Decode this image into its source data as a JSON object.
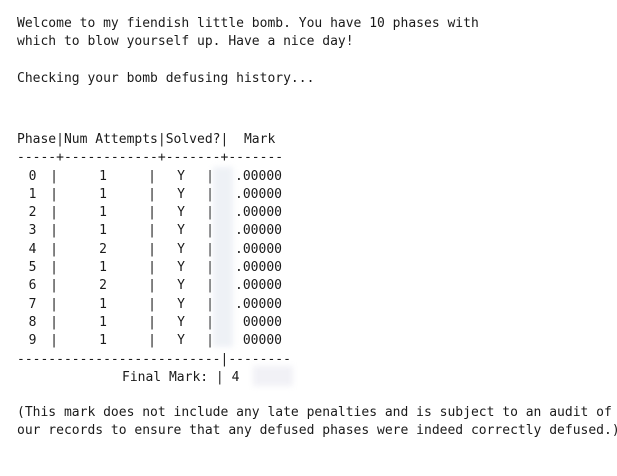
{
  "intro": {
    "line1": "Welcome to my fiendish little bomb. You have 10 phases with",
    "line2": "which to blow yourself up. Have a nice day!",
    "checking": "Checking your bomb defusing history..."
  },
  "table": {
    "header": "Phase|Num Attempts|Solved?|  Mark",
    "separator_top": "-----+------------+-------+-------",
    "rows": [
      {
        "phase": "0",
        "attempts": "1",
        "solved": "Y",
        "mark": ".00000"
      },
      {
        "phase": "1",
        "attempts": "1",
        "solved": "Y",
        "mark": ".00000"
      },
      {
        "phase": "2",
        "attempts": "1",
        "solved": "Y",
        "mark": ".00000"
      },
      {
        "phase": "3",
        "attempts": "1",
        "solved": "Y",
        "mark": ".00000"
      },
      {
        "phase": "4",
        "attempts": "2",
        "solved": "Y",
        "mark": ".00000"
      },
      {
        "phase": "5",
        "attempts": "1",
        "solved": "Y",
        "mark": ".00000"
      },
      {
        "phase": "6",
        "attempts": "2",
        "solved": "Y",
        "mark": ".00000"
      },
      {
        "phase": "7",
        "attempts": "1",
        "solved": "Y",
        "mark": ".00000"
      },
      {
        "phase": "8",
        "attempts": "1",
        "solved": "Y",
        "mark": "00000"
      },
      {
        "phase": "9",
        "attempts": "1",
        "solved": "Y",
        "mark": "00000"
      }
    ],
    "separator_bottom": "--------------------------|--------",
    "final_label": "Final Mark:",
    "final_value": "4"
  },
  "notice": {
    "line1": "(This mark does not include any late penalties and is subject to an audit of",
    "line2": "our records to ensure that any defused phases were indeed correctly defused.)"
  }
}
